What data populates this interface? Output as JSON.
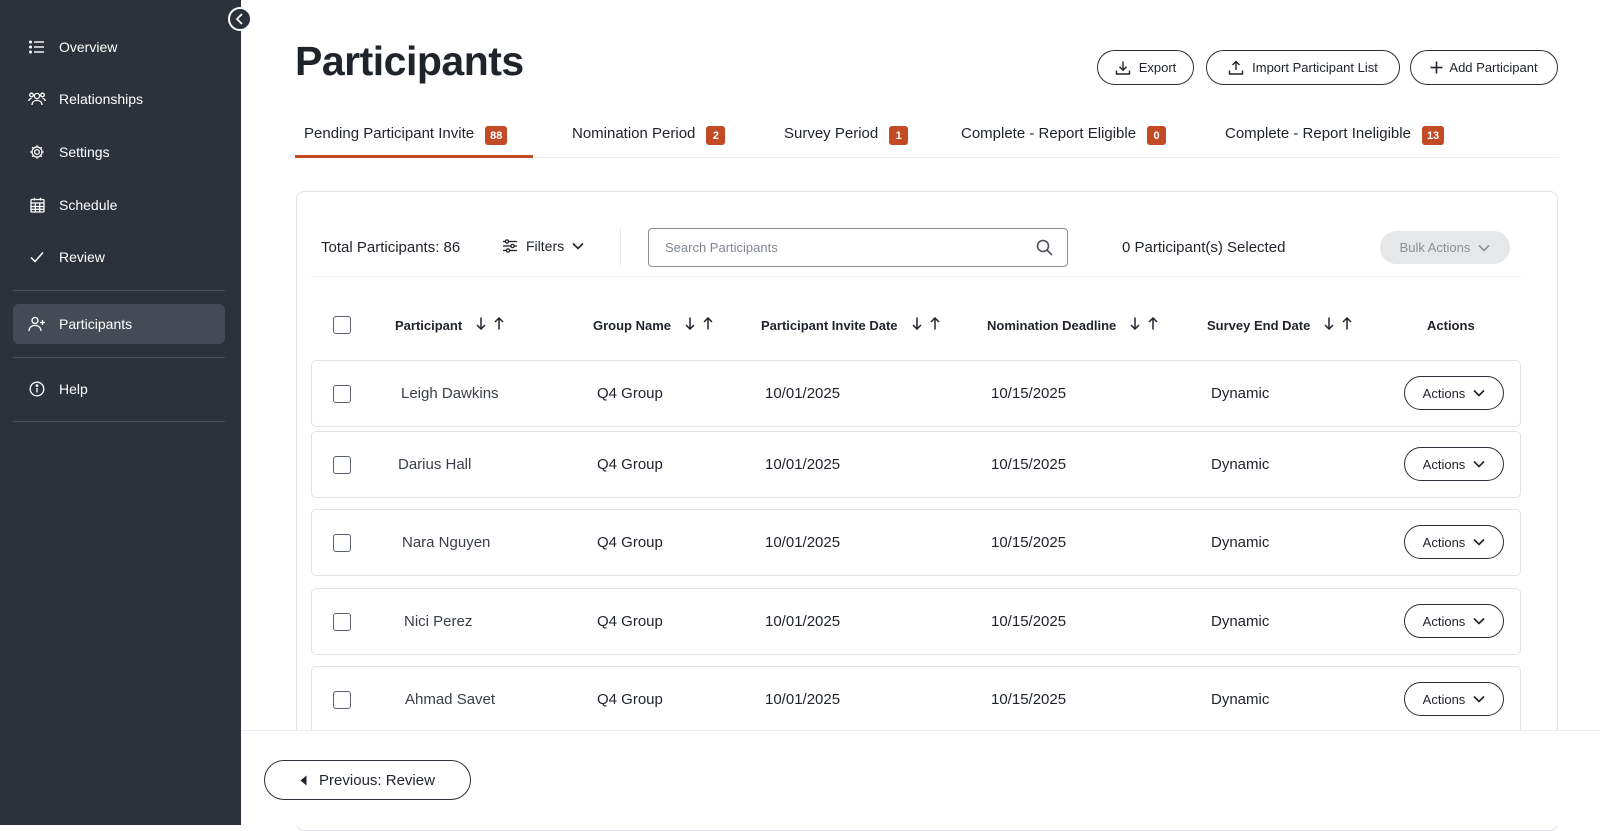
{
  "sidebar": {
    "items": [
      {
        "label": "Overview",
        "icon": "list-icon"
      },
      {
        "label": "Relationships",
        "icon": "people-icon"
      },
      {
        "label": "Settings",
        "icon": "gear-icon"
      },
      {
        "label": "Schedule",
        "icon": "calendar-icon"
      },
      {
        "label": "Review",
        "icon": "check-icon"
      },
      {
        "label": "Participants",
        "icon": "add-person-icon",
        "active": true
      },
      {
        "label": "Help",
        "icon": "info-icon"
      }
    ]
  },
  "header": {
    "title": "Participants",
    "export_label": "Export",
    "import_label": "Import Participant List",
    "add_label": "Add Participant"
  },
  "tabs": [
    {
      "label": "Pending Participant Invite",
      "count": "88",
      "active": true
    },
    {
      "label": "Nomination Period",
      "count": "2"
    },
    {
      "label": "Survey Period",
      "count": "1"
    },
    {
      "label": "Complete - Report Eligible",
      "count": "0"
    },
    {
      "label": "Complete - Report Ineligible",
      "count": "13"
    }
  ],
  "toolbar": {
    "total_label": "Total Participants: 86",
    "filters_label": "Filters",
    "search_placeholder": "Search Participants",
    "selected_label": "0 Participant(s) Selected",
    "bulk_actions_label": "Bulk Actions"
  },
  "table": {
    "columns": [
      "Participant",
      "Group Name",
      "Participant Invite Date",
      "Nomination Deadline",
      "Survey End Date",
      "Actions"
    ],
    "rows": [
      {
        "participant": "Leigh Dawkins",
        "group": "Q4 Group",
        "invite_date": "10/01/2025",
        "nomination_deadline": "10/15/2025",
        "survey_end": "Dynamic",
        "action_label": "Actions"
      },
      {
        "participant": "Darius Hall",
        "group": "Q4 Group",
        "invite_date": "10/01/2025",
        "nomination_deadline": "10/15/2025",
        "survey_end": "Dynamic",
        "action_label": "Actions"
      },
      {
        "participant": "Nara Nguyen",
        "group": "Q4 Group",
        "invite_date": "10/01/2025",
        "nomination_deadline": "10/15/2025",
        "survey_end": "Dynamic",
        "action_label": "Actions"
      },
      {
        "participant": "Nici Perez",
        "group": "Q4 Group",
        "invite_date": "10/01/2025",
        "nomination_deadline": "10/15/2025",
        "survey_end": "Dynamic",
        "action_label": "Actions"
      },
      {
        "participant": "Ahmad Savet",
        "group": "Q4 Group",
        "invite_date": "10/01/2025",
        "nomination_deadline": "10/15/2025",
        "survey_end": "Dynamic",
        "action_label": "Actions"
      }
    ]
  },
  "footer": {
    "previous_label": "Previous: Review"
  },
  "colors": {
    "sidebar_bg": "#2d323a",
    "accent": "#c24a24",
    "active_nav_bg": "#454b54"
  }
}
